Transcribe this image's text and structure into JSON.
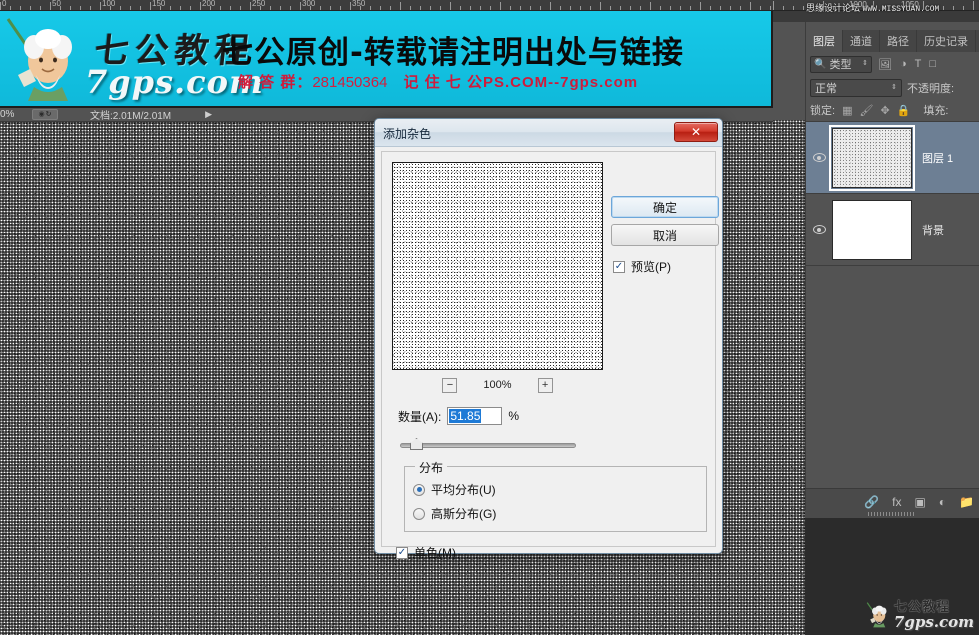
{
  "app": {
    "status_bar": {
      "zoom": "0%",
      "doc_label": "文档:2.01M/2.01M",
      "arrow": "▶"
    },
    "ruler": {
      "left_labels": [
        "0",
        "50",
        "100",
        "150",
        "200",
        "250",
        "300",
        "350"
      ],
      "right_labels": [
        "1000",
        "1050"
      ]
    }
  },
  "banner": {
    "logo_cn": "七公教程",
    "logo_url": "7gps.com",
    "headline": "七公原创-转载请注明出处与链接",
    "qq_label": "解 答 群：",
    "qq_number": "281450364",
    "remember": "记 住 七 公PS.COM--7gps.com"
  },
  "watermark": {
    "top_forum": "思缘设计论坛",
    "top_site": "WWW.MISSYUAN.COM",
    "bottom_cn": "七公教程",
    "bottom_url": "7gps.com"
  },
  "layers_panel": {
    "tabs": [
      {
        "label": "图层",
        "active": true
      },
      {
        "label": "通道",
        "active": false
      },
      {
        "label": "路径",
        "active": false
      },
      {
        "label": "历史记录",
        "active": false
      }
    ],
    "filter": {
      "icon": "search-icon",
      "value": "类型",
      "spinner": "⇕",
      "icons": [
        "image-icon",
        "adjustment-icon",
        "type-icon",
        "shape-icon"
      ]
    },
    "blend_mode": {
      "value": "正常",
      "spinner": "⇕"
    },
    "opacity_label": "不透明度:",
    "lock_label": "锁定:",
    "lock_icons": [
      "transparency-lock-icon",
      "brush-lock-icon",
      "move-lock-icon",
      "all-lock-icon"
    ],
    "fill_label": "填充:",
    "layers": [
      {
        "name": "图层 1",
        "selected": true,
        "visible": true,
        "thumb": "noise"
      },
      {
        "name": "背景",
        "selected": false,
        "visible": true,
        "thumb": "white"
      }
    ],
    "bottom_icons": [
      "link-icon",
      "fx-icon",
      "mask-icon",
      "adjustment-layer-icon",
      "group-icon"
    ],
    "fx_label": "fx"
  },
  "dialog": {
    "title": "添加杂色",
    "close_label": "✕",
    "preview_zoom": {
      "minus": "−",
      "value": "100%",
      "plus": "+"
    },
    "amount": {
      "label": "数量(A):",
      "value": "51.85",
      "unit": "%"
    },
    "group": {
      "title": "分布",
      "options": [
        {
          "label": "平均分布(U)",
          "checked": true
        },
        {
          "label": "高斯分布(G)",
          "checked": false
        }
      ]
    },
    "monochrome": {
      "label": "单色(M)",
      "checked": true,
      "mark": "✓"
    },
    "buttons": {
      "ok": "确定",
      "cancel": "取消"
    },
    "preview_checkbox": {
      "label": "预览(P)",
      "checked": true,
      "mark": "✓"
    }
  },
  "colors": {
    "accent_blue": "#1e7ad6",
    "banner_cyan": "#13c2e2",
    "panel_gray": "#535353",
    "close_red": "#c8301f"
  }
}
